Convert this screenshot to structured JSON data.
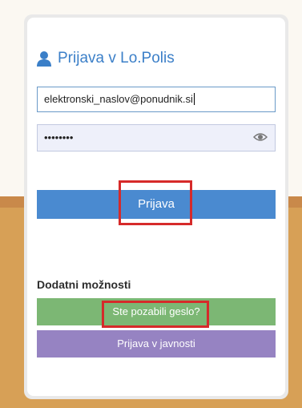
{
  "login_form": {
    "title": "Prijava v Lo.Polis",
    "title_icon": "user-icon",
    "email_value": "elektronski_naslov@ponudnik.si",
    "password_masked": "••••••••",
    "show_password_icon": "eye-icon",
    "login_button": "Prijava"
  },
  "extra_options": {
    "heading": "Dodatni možnosti",
    "forgot_password_button": "Ste pozabili geslo?",
    "public_login_button": "Prijava v javnosti"
  },
  "colors": {
    "accent_blue": "#4a8ad0",
    "green": "#7cb774",
    "purple": "#9683c2",
    "highlight_red": "#d62a2a",
    "page_orange": "#d7a056"
  }
}
